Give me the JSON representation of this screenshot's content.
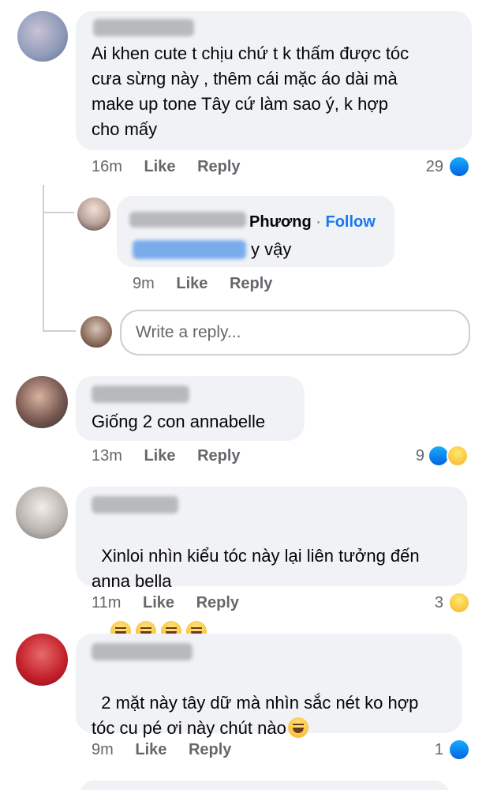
{
  "comments": [
    {
      "text": "Ai khen cute t chịu chứ t k thấm được tóc\ncưa sừng này , thêm cái mặc áo dài mà\nmake up tone Tây cứ làm sao ý, k hợp\ncho mấy",
      "time": "16m",
      "like": "Like",
      "reply": "Reply",
      "count": "29",
      "reactions": [
        "like-icon"
      ]
    },
    {
      "text": "Giống 2 con annabelle",
      "time": "13m",
      "like": "Like",
      "reply": "Reply",
      "count": "9",
      "reactions": [
        "like-icon",
        "haha-icon"
      ]
    },
    {
      "text": "Xinloi nhìn kiểu tóc này lại liên tưởng đến\nanna bella",
      "time": "11m",
      "like": "Like",
      "reply": "Reply",
      "count": "3",
      "reactions": [
        "haha-icon"
      ]
    },
    {
      "text": "2 mặt này tây dữ mà nhìn sắc nét ko hợp\ntóc cu pé ơi này chút nào",
      "time": "9m",
      "like": "Like",
      "reply": "Reply",
      "count": "1",
      "reactions": [
        "like-icon"
      ]
    }
  ],
  "reply1": {
    "name_visible": "Phương",
    "separator": "·",
    "follow": "Follow",
    "text_tail": "y vậy",
    "time": "9m",
    "like": "Like",
    "reply": "Reply"
  },
  "reply_box": {
    "placeholder": "Write a reply..."
  },
  "colors": {
    "bubble": "#f0f2f5",
    "accent": "#1877f2",
    "meta": "#65676b",
    "thread_line": "#ccd0d5"
  }
}
